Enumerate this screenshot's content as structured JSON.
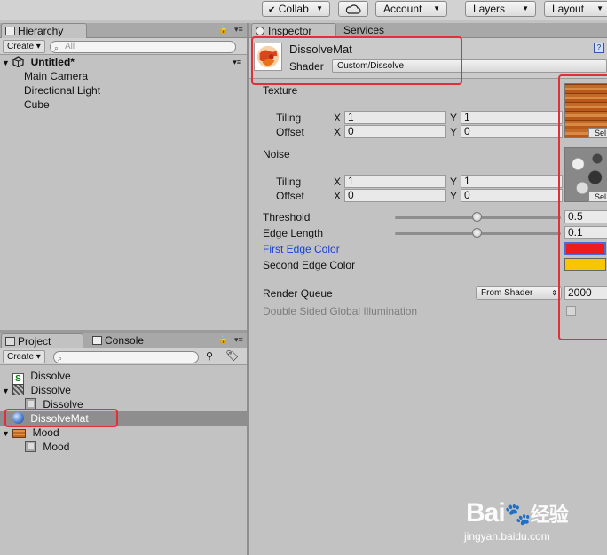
{
  "toolbar": {
    "collab_label": "Collab",
    "account_label": "Account",
    "layers_label": "Layers",
    "layout_label": "Layout"
  },
  "hierarchy": {
    "tab_label": "Hierarchy",
    "create_label": "Create",
    "search_placeholder": "All",
    "scene_name": "Untitled*",
    "items": [
      "Main Camera",
      "Directional Light",
      "Cube"
    ]
  },
  "project": {
    "tab_label": "Project",
    "console_tab_label": "Console",
    "create_label": "Create",
    "items": [
      {
        "label": "Dissolve",
        "icon": "shader-script-icon"
      },
      {
        "label": "Dissolve",
        "icon": "noise-texture-icon"
      },
      {
        "label": "Dissolve",
        "icon": "sprite-icon"
      },
      {
        "label": "DissolveMat",
        "icon": "material-sphere-icon",
        "selected": true
      },
      {
        "label": "Mood",
        "icon": "wood-texture-icon"
      },
      {
        "label": "Mood",
        "icon": "sprite-icon"
      }
    ]
  },
  "inspector": {
    "tab_label": "Inspector",
    "services_tab_label": "Services",
    "material_name": "DissolveMat",
    "shader_label": "Shader",
    "shader_value": "Custom/Dissolve",
    "texture_label": "Texture",
    "noise_label": "Noise",
    "tiling_label": "Tiling",
    "offset_label": "Offset",
    "x_label": "X",
    "y_label": "Y",
    "texture_tiling_x": "1",
    "texture_tiling_y": "1",
    "texture_offset_x": "0",
    "texture_offset_y": "0",
    "noise_tiling_x": "1",
    "noise_tiling_y": "1",
    "noise_offset_x": "0",
    "noise_offset_y": "0",
    "select_label": "Sel",
    "threshold_label": "Threshold",
    "threshold_value": "0.5",
    "edge_length_label": "Edge Length",
    "edge_length_value": "0.1",
    "first_edge_color_label": "First Edge Color",
    "first_edge_color": "#ee1c1c",
    "second_edge_color_label": "Second Edge Color",
    "second_edge_color": "#f7c600",
    "render_queue_label": "Render Queue",
    "render_queue_mode": "From Shader",
    "render_queue_value": "2000",
    "dsgi_label": "Double Sided Global Illumination"
  },
  "watermark": {
    "brand": "Bai",
    "brand2": "经验",
    "url": "jingyan.baidu.com"
  },
  "colors": {
    "highlight_red": "#e0303a",
    "link_blue": "#1a3fd6",
    "selection_gray": "#8e8e8e"
  }
}
